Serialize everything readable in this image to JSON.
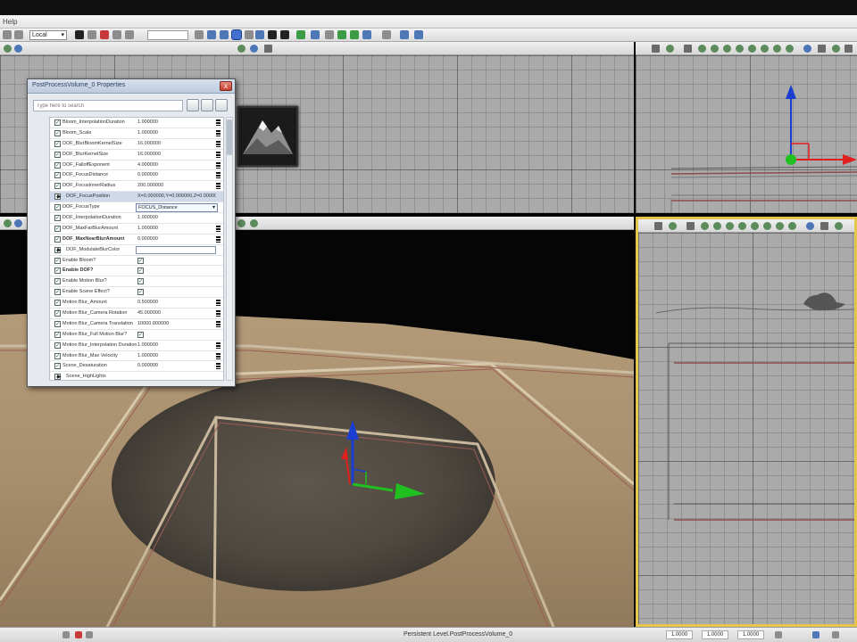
{
  "window": {
    "title": ""
  },
  "menu": {
    "items": [
      "Help"
    ]
  },
  "toolbar": {
    "coordinate_system": "Local"
  },
  "properties_panel": {
    "title": "PostProcessVolume_0 Properties",
    "search_placeholder": "Type here to search",
    "close_label": "x",
    "rows": [
      {
        "enabled": true,
        "name": "Bloom_InterpolationDuration",
        "value": "1.000000",
        "handle": true
      },
      {
        "enabled": true,
        "name": "Bloom_Scale",
        "value": "1.000000",
        "handle": true
      },
      {
        "enabled": true,
        "name": "DOF_BlurBloomKernelSize",
        "value": "16.000000",
        "handle": true
      },
      {
        "enabled": true,
        "name": "DOF_BlurKernelSize",
        "value": "16.000000",
        "handle": true
      },
      {
        "enabled": true,
        "name": "DOF_FalloffExponent",
        "value": "4.000000",
        "handle": true
      },
      {
        "enabled": true,
        "name": "DOF_FocusDistance",
        "value": "0.000000",
        "handle": true
      },
      {
        "enabled": true,
        "name": "DOF_FocusInnerRadius",
        "value": "200.000000",
        "handle": true
      },
      {
        "enabled": true,
        "name": "DOF_FocusPosition",
        "value": "X=0.000000,Y=0.000000,Z=0.000000",
        "expander": true,
        "selected": true
      },
      {
        "enabled": true,
        "name": "DOF_FocusType",
        "value": "FOCUS_Distance",
        "combo": true
      },
      {
        "enabled": true,
        "name": "DOF_InterpolationDuration",
        "value": "1.000000"
      },
      {
        "enabled": true,
        "name": "DOF_MaxFarBlurAmount",
        "value": "1.000000",
        "handle": true
      },
      {
        "enabled": true,
        "name": "DOF_MaxNearBlurAmount",
        "value": "0.000000",
        "bold": true,
        "handle": true
      },
      {
        "enabled": true,
        "name": "DOF_ModulateBlurColor",
        "value": "",
        "expander": true,
        "box": true
      },
      {
        "enabled": true,
        "name": "Enable Bloom?",
        "value": "",
        "value_check": true
      },
      {
        "enabled": true,
        "name": "Enable DOF?",
        "value": "",
        "value_check": true,
        "bold": true
      },
      {
        "enabled": true,
        "name": "Enable Motion Blur?",
        "value": "",
        "value_check": true
      },
      {
        "enabled": true,
        "name": "Enable Scene Effect?",
        "value": "",
        "value_check": true
      },
      {
        "enabled": true,
        "name": "Motion Blur_Amount",
        "value": "0.500000",
        "handle": true
      },
      {
        "enabled": true,
        "name": "Motion Blur_Camera Rotation",
        "value": "45.000000",
        "handle": true
      },
      {
        "enabled": true,
        "name": "Motion Blur_Camera Translation",
        "value": "10000.000000",
        "handle": true
      },
      {
        "enabled": true,
        "name": "Motion Blur_Full Motion Blur?",
        "value": "",
        "value_check": true
      },
      {
        "enabled": true,
        "name": "Motion Blur_Interpolation Duration",
        "value": "1.000000",
        "handle": true
      },
      {
        "enabled": true,
        "name": "Motion Blur_Max Velocity",
        "value": "1.000000",
        "handle": true
      },
      {
        "enabled": true,
        "name": "Scene_Desaturation",
        "value": "0.000000",
        "handle": true
      },
      {
        "enabled": true,
        "name": "Scene_HighLights",
        "value": "",
        "expander": true
      }
    ]
  },
  "status_bar": {
    "level_text": "Persistent Level.PostProcessVolume_0",
    "grid_values": [
      "1.0000",
      "1.0000",
      "1.0000"
    ]
  },
  "colors": {
    "axis_x": "#e02020",
    "axis_y": "#20c020",
    "axis_z": "#1a3fd0",
    "active_viewport_border": "#e5c64a",
    "grid_background": "#aaaaaa"
  }
}
